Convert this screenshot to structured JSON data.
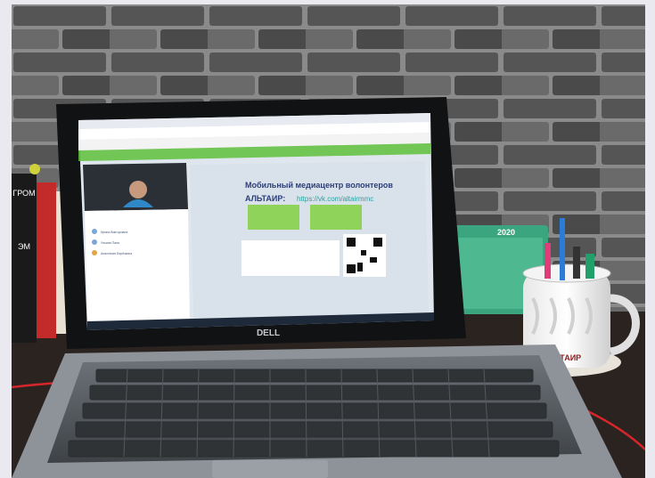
{
  "slide": {
    "title": "Мобильный медиацентр волонтеров",
    "subtitle_prefix": "АЛЬТАИР:",
    "link": "https://vk.com/altairmmc"
  },
  "laptop": {
    "brand": "DELL"
  },
  "calendar": {
    "year": "2020"
  },
  "mug": {
    "logo": "АЛЬТАИР"
  },
  "books": {
    "spine_1": "ГРОМ",
    "spine_2": "ЭМ"
  },
  "participants": [
    "Ирина Викторовна",
    "Ульяна Пана",
    "Анастасия Берёзкина"
  ],
  "colors": {
    "bg_frame": "#e9e9ef",
    "brick": "#5b5b5b",
    "table": "#2a2320",
    "screen_bg": "#dfe6ee",
    "accent_green": "#5fbf3a",
    "cable_red": "#d6262b",
    "teal": "#3aa57f"
  }
}
